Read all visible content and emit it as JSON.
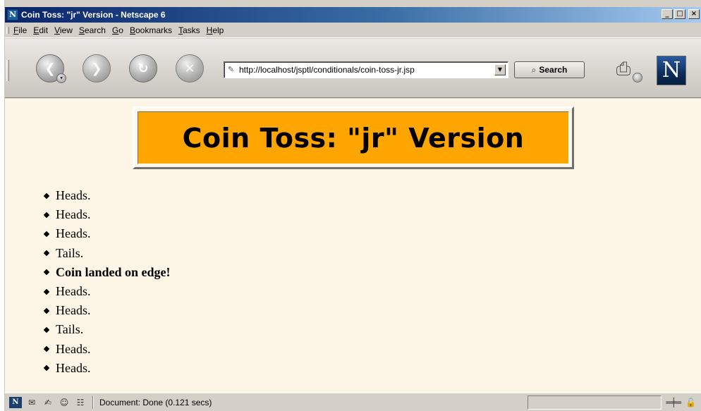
{
  "window": {
    "title": "Coin Toss: \"jr\" Version - Netscape 6",
    "app_icon": "N",
    "controls": {
      "minimize": "_",
      "maximize": "□",
      "close": "×"
    }
  },
  "menu": [
    "File",
    "Edit",
    "View",
    "Search",
    "Go",
    "Bookmarks",
    "Tasks",
    "Help"
  ],
  "toolbar": {
    "back_icon": "back-arrow-icon",
    "forward_icon": "forward-arrow-icon",
    "reload_icon": "reload-icon",
    "stop_icon": "stop-icon",
    "url": "http://localhost/jsptl/conditionals/coin-toss-jr.jsp",
    "search_label": "Search",
    "logo": "N"
  },
  "page": {
    "heading": "Coin Toss: \"jr\" Version",
    "heading_bg": "#ffa500",
    "background": "#fdf5e6",
    "results": [
      {
        "text": "Heads.",
        "bold": false
      },
      {
        "text": "Heads.",
        "bold": false
      },
      {
        "text": "Heads.",
        "bold": false
      },
      {
        "text": "Tails.",
        "bold": false
      },
      {
        "text": "Coin landed on edge!",
        "bold": true
      },
      {
        "text": "Heads.",
        "bold": false
      },
      {
        "text": "Heads.",
        "bold": false
      },
      {
        "text": "Tails.",
        "bold": false
      },
      {
        "text": "Heads.",
        "bold": false
      },
      {
        "text": "Heads.",
        "bold": false
      }
    ]
  },
  "status": {
    "text": "Document: Done (0.121 secs)"
  }
}
